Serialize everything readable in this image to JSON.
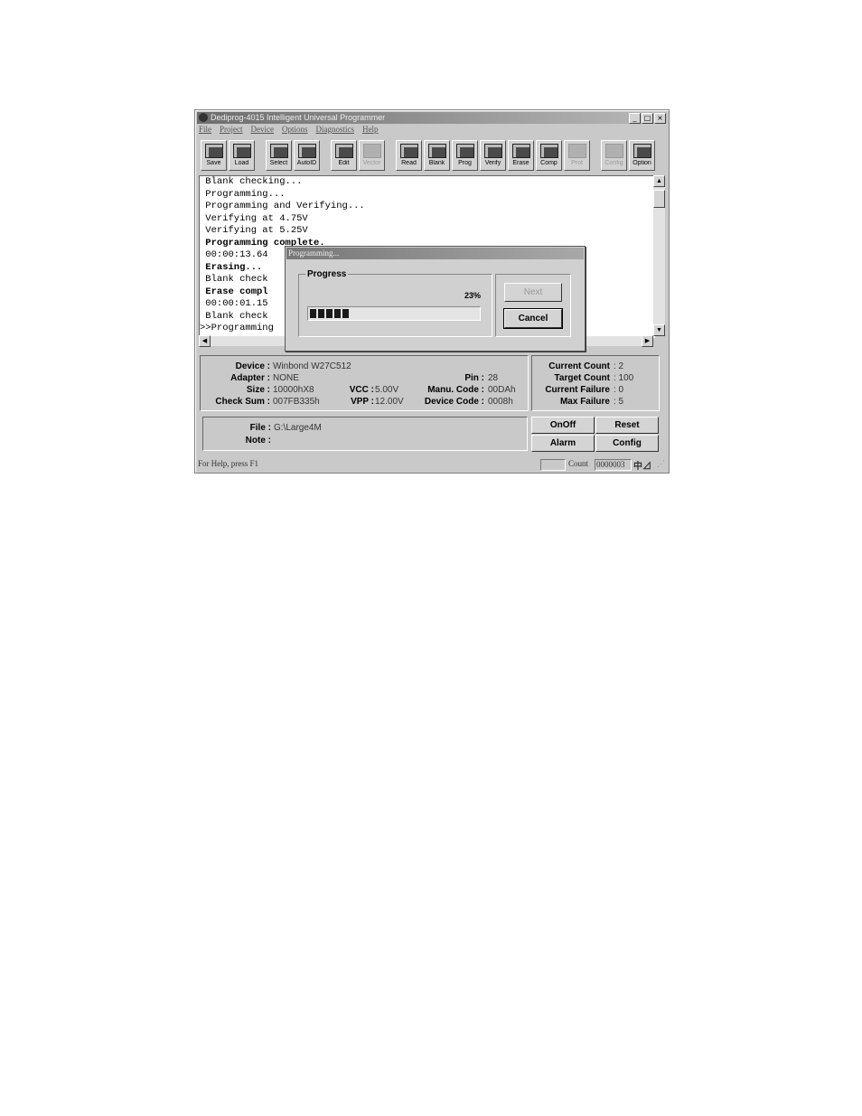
{
  "window": {
    "title": "Dediprog-4015 Intelligent Universal Programmer"
  },
  "menu": [
    "File",
    "Project",
    "Device",
    "Options",
    "Diagnostics",
    "Help"
  ],
  "toolbar": [
    {
      "label": "Save",
      "icon": "save-icon",
      "enabled": true
    },
    {
      "label": "Load",
      "icon": "load-icon",
      "enabled": true
    },
    {
      "label": "Select",
      "icon": "select-device-icon",
      "enabled": true
    },
    {
      "label": "AutoID",
      "icon": "chip-icon",
      "enabled": true
    },
    {
      "label": "Edit",
      "icon": "edit-icon",
      "enabled": true
    },
    {
      "label": "Vector",
      "icon": "vector-icon",
      "enabled": false
    },
    {
      "label": "Read",
      "icon": "read-icon",
      "enabled": true
    },
    {
      "label": "Blank",
      "icon": "blank-icon",
      "enabled": true
    },
    {
      "label": "Prog",
      "icon": "program-icon",
      "enabled": true
    },
    {
      "label": "Verify",
      "icon": "verify-icon",
      "enabled": true
    },
    {
      "label": "Erase",
      "icon": "erase-icon",
      "enabled": true
    },
    {
      "label": "Comp",
      "icon": "compare-icon",
      "enabled": true
    },
    {
      "label": "Prot",
      "icon": "protect-icon",
      "enabled": false
    },
    {
      "label": "Config",
      "icon": "config-icon",
      "enabled": false
    },
    {
      "label": "Option",
      "icon": "option-icon",
      "enabled": true
    }
  ],
  "log": [
    {
      "text": " Blank checking...",
      "bold": false
    },
    {
      "text": " Programming...",
      "bold": false
    },
    {
      "text": " Programming and Verifying...",
      "bold": false
    },
    {
      "text": " Verifying at 4.75V",
      "bold": false
    },
    {
      "text": " Verifying at 5.25V",
      "bold": false
    },
    {
      "text": " Programming complete.",
      "bold": true
    },
    {
      "text": " 00:00:13.64",
      "bold": false
    },
    {
      "text": " Erasing...",
      "bold": true
    },
    {
      "text": " Blank check",
      "bold": false
    },
    {
      "text": " Erase compl",
      "bold": true
    },
    {
      "text": " 00:00:01.15",
      "bold": false
    },
    {
      "text": " Blank check",
      "bold": false
    },
    {
      "text": ">>Programming",
      "bold": false
    }
  ],
  "device_info": {
    "device_label": "Device :",
    "device_value": "Winbond W27C512",
    "adapter_label": "Adapter :",
    "adapter_value": "NONE",
    "pin_label": "Pin :",
    "pin_value": "28",
    "size_label": "Size :",
    "size_value": "10000hX8",
    "vcc_label": "VCC :",
    "vcc_value": "5.00V",
    "manu_label": "Manu. Code :",
    "manu_value": "00DAh",
    "checksum_label": "Check Sum :",
    "checksum_value": "007FB335h",
    "vpp_label": "VPP :",
    "vpp_value": "12.00V",
    "devcode_label": "Device Code :",
    "devcode_value": "0008h"
  },
  "counts": {
    "current_count_label": "Current Count",
    "current_count": ": 2",
    "target_count_label": "Target Count",
    "target_count": ": 100",
    "current_failure_label": "Current Failure",
    "current_failure": ": 0",
    "max_failure_label": "Max Failure",
    "max_failure": ": 5"
  },
  "file": {
    "file_label": "File :",
    "file_value": "G:\\Large4M",
    "note_label": "Note :",
    "note_value": ""
  },
  "buttons": {
    "onoff": "OnOff",
    "reset": "Reset",
    "alarm": "Alarm",
    "config": "Config"
  },
  "status": {
    "help": "For Help, press F1",
    "count_label": "Count",
    "count_value": "0000003"
  },
  "dialog": {
    "title": "Programming...",
    "group": "Progress",
    "percent_text": "23%",
    "progress": 0.23,
    "next": "Next",
    "cancel": "Cancel"
  }
}
